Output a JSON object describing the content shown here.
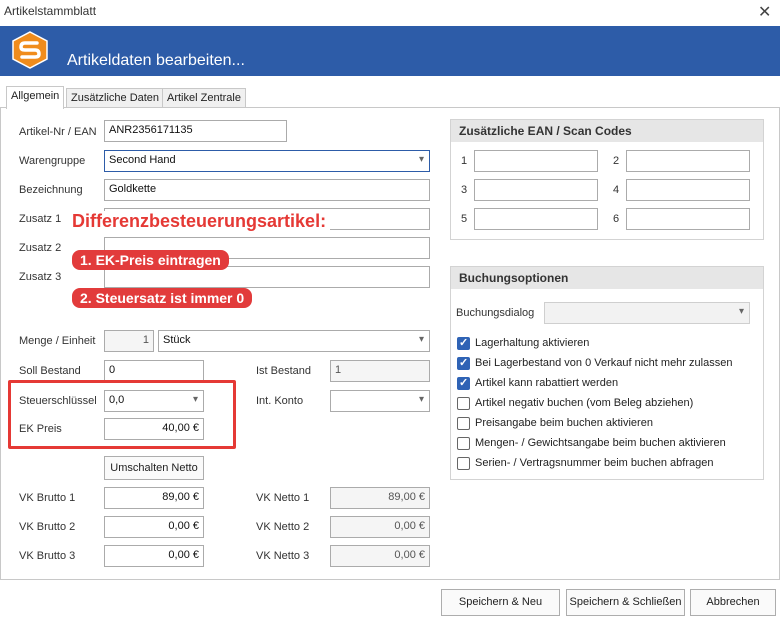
{
  "window": {
    "title": "Artikelstammblatt",
    "close": "✕"
  },
  "banner": {
    "title": "Artikeldaten bearbeiten..."
  },
  "tabs": [
    {
      "label": "Allgemein"
    },
    {
      "label": "Zusätzliche Daten"
    },
    {
      "label": "Artikel Zentrale"
    }
  ],
  "form": {
    "artnr_label": "Artikel-Nr / EAN",
    "artnr_value": "ANR2356171135",
    "warengruppe_label": "Warengruppe",
    "warengruppe_value": "Second Hand",
    "bezeichnung_label": "Bezeichnung",
    "bezeichnung_value": "Goldkette",
    "zusatz1_label": "Zusatz 1",
    "zusatz2_label": "Zusatz 2",
    "zusatz3_label": "Zusatz 3",
    "menge_label": "Menge / Einheit",
    "menge_value": "1",
    "einheit_value": "Stück",
    "soll_label": "Soll Bestand",
    "soll_value": "0",
    "ist_label": "Ist Bestand",
    "ist_value": "1",
    "steuer_label": "Steuerschlüssel",
    "steuer_value": "0,0",
    "konto_label": "Int. Konto",
    "konto_value": "",
    "ek_label": "EK Preis",
    "ek_value": "40,00 €",
    "umschalten_label": "Umschalten Netto",
    "vkb1_label": "VK Brutto 1",
    "vkb1_value": "89,00 €",
    "vkb2_label": "VK Brutto 2",
    "vkb2_value": "0,00 €",
    "vkb3_label": "VK Brutto 3",
    "vkb3_value": "0,00 €",
    "vkn1_label": "VK Netto 1",
    "vkn1_value": "89,00 €",
    "vkn2_label": "VK Netto 2",
    "vkn2_value": "0,00 €",
    "vkn3_label": "VK Netto 3",
    "vkn3_value": "0,00 €"
  },
  "ean": {
    "title": "Zusätzliche EAN / Scan Codes",
    "labels": [
      "1",
      "2",
      "3",
      "4",
      "5",
      "6"
    ]
  },
  "buchung": {
    "title": "Buchungsoptionen",
    "dialog_label": "Buchungsdialog",
    "options": [
      {
        "label": "Lagerhaltung aktivieren",
        "checked": true
      },
      {
        "label": "Bei Lagerbestand von 0 Verkauf nicht mehr zulassen",
        "checked": true
      },
      {
        "label": "Artikel kann rabattiert werden",
        "checked": true
      },
      {
        "label": "Artikel negativ buchen (vom Beleg abziehen)",
        "checked": false
      },
      {
        "label": "Preisangabe beim buchen aktivieren",
        "checked": false
      },
      {
        "label": "Mengen- / Gewichtsangabe beim buchen aktivieren",
        "checked": false
      },
      {
        "label": "Serien- / Vertragsnummer beim buchen abfragen",
        "checked": false
      }
    ]
  },
  "annotation": {
    "heading": "Differenzbesteuerungsartikel:",
    "step1": "1. EK-Preis eintragen",
    "step2": "2. Steuersatz ist immer 0"
  },
  "footer": {
    "save_new": "Speichern & Neu",
    "save_close": "Speichern & Schließen",
    "cancel": "Abbrechen"
  },
  "colors": {
    "banner": "#2d5ca8",
    "annotation": "#e53935",
    "checkbox": "#2f63b5"
  }
}
